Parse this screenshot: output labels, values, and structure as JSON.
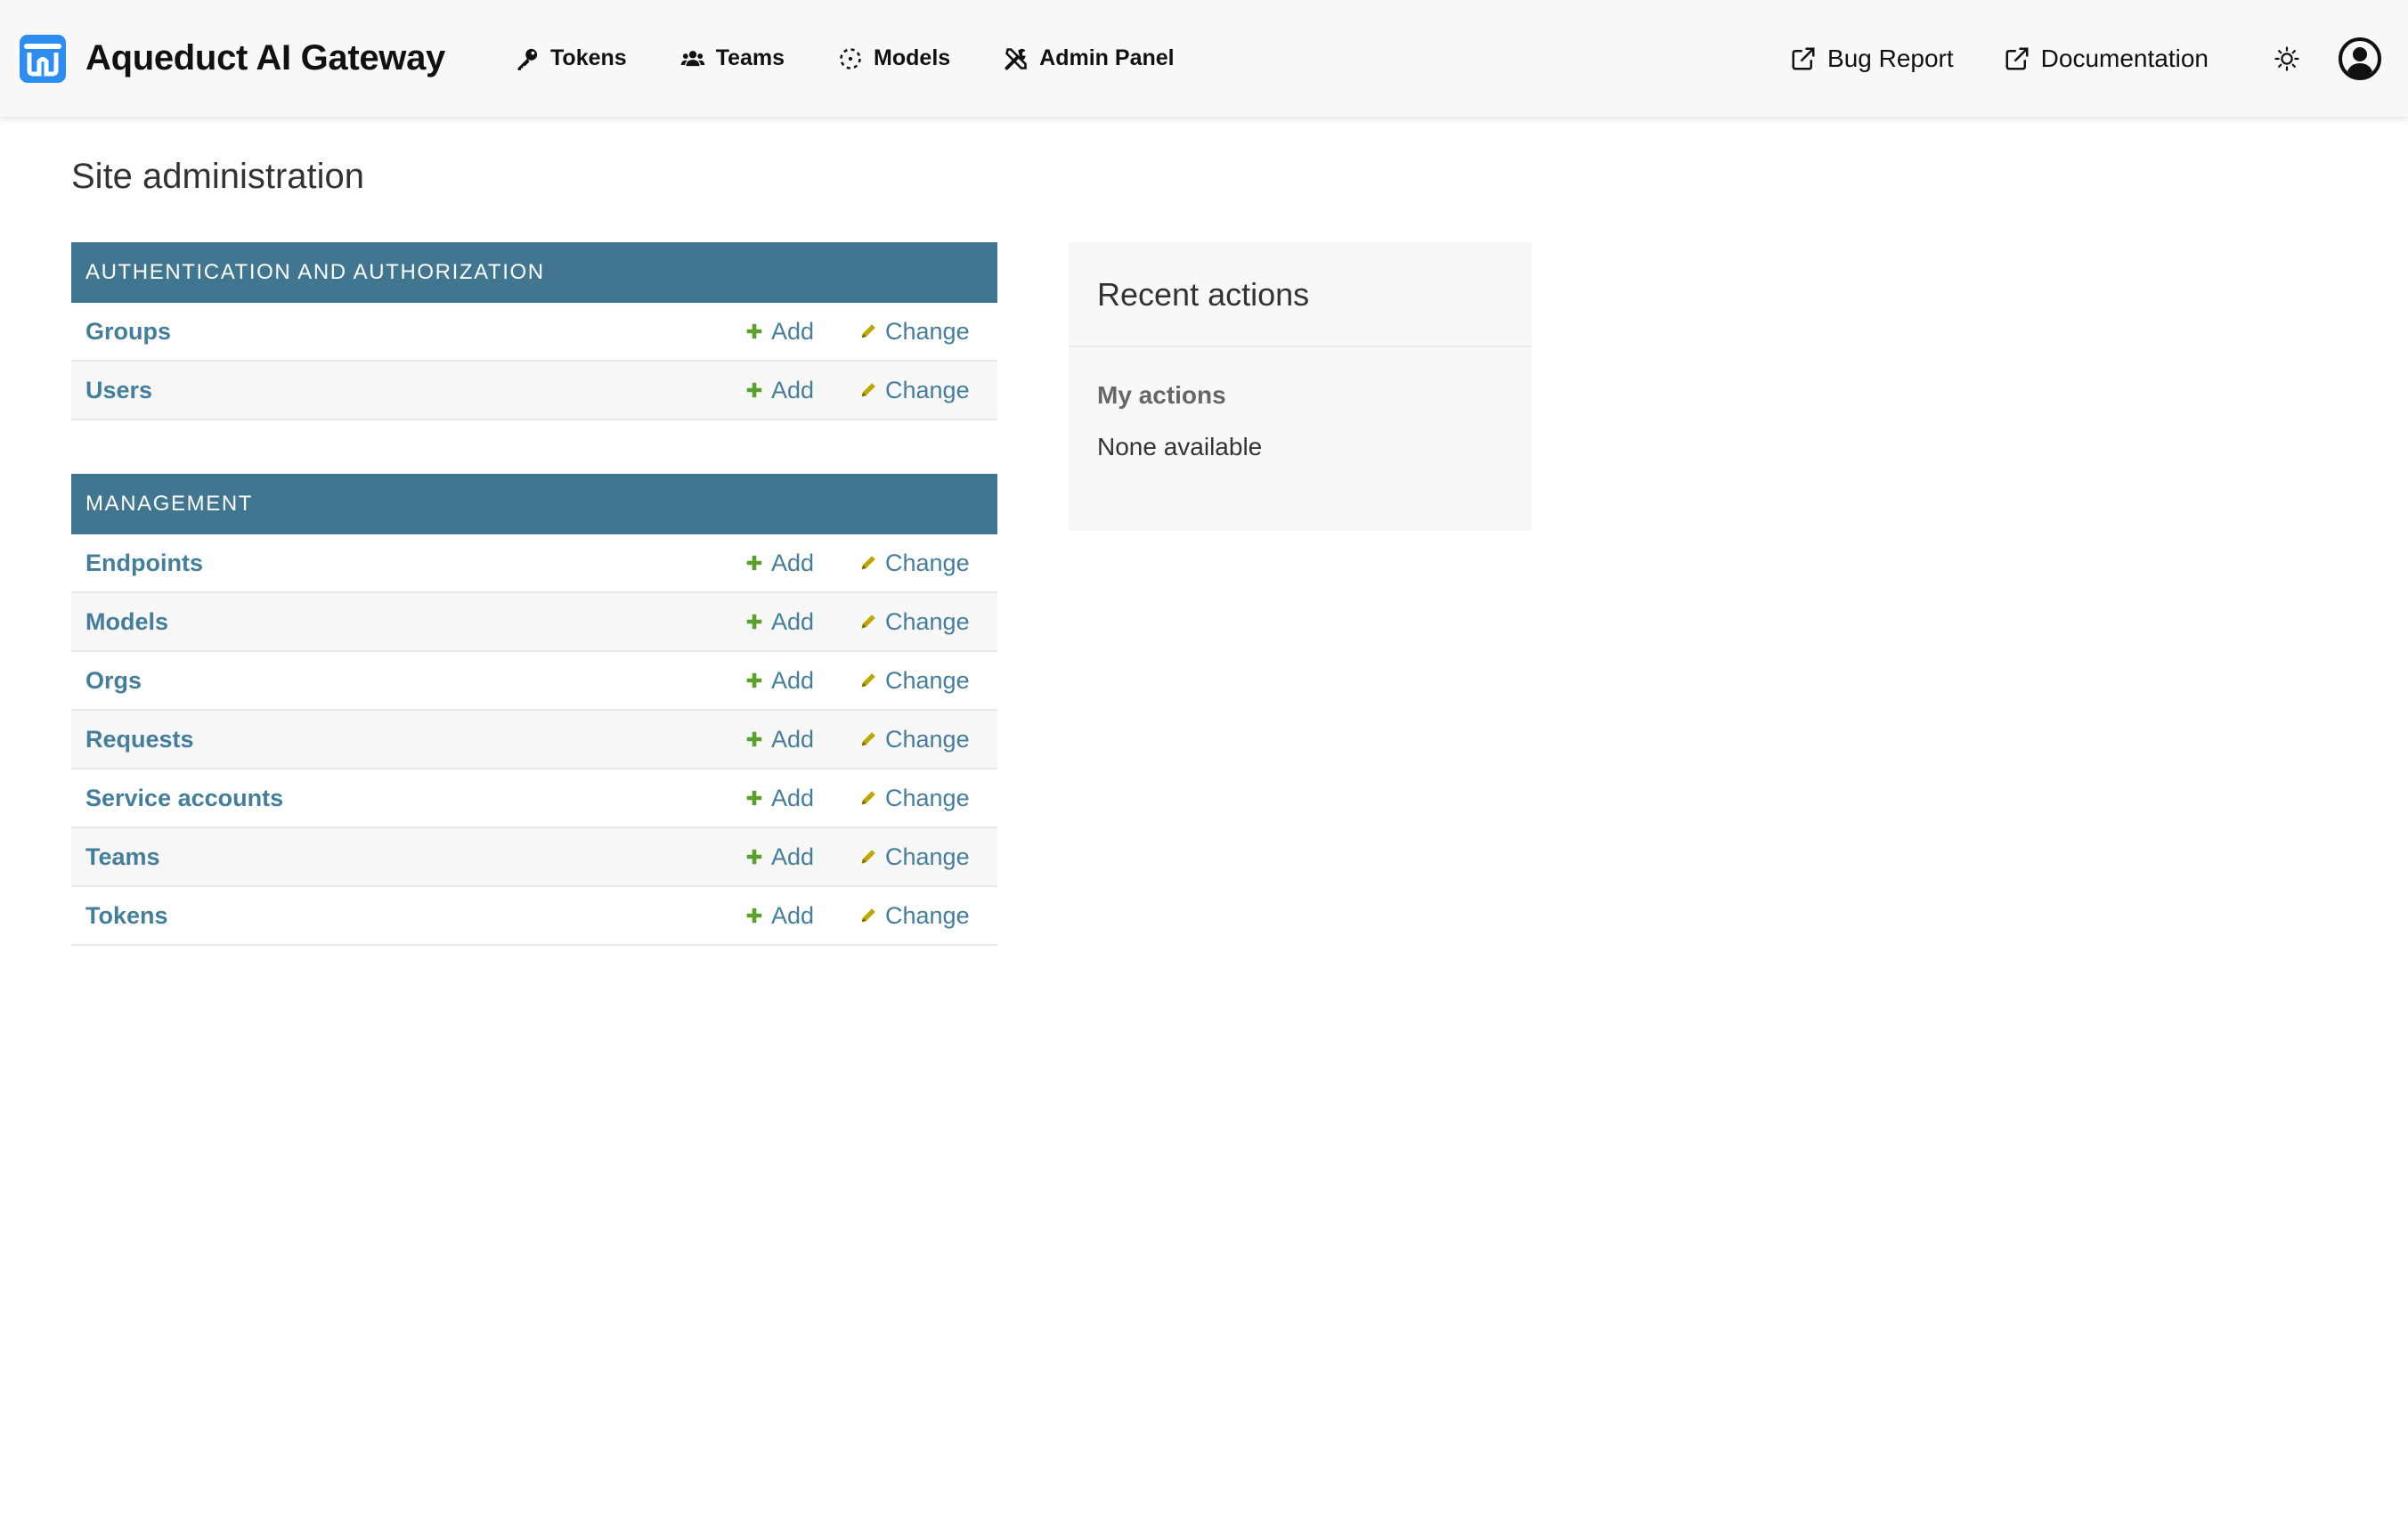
{
  "brand": {
    "name": "Aqueduct AI Gateway",
    "logo_color": "#2d8cf0"
  },
  "nav": {
    "items": [
      {
        "label": "Tokens",
        "icon": "key-icon"
      },
      {
        "label": "Teams",
        "icon": "users-icon"
      },
      {
        "label": "Models",
        "icon": "dashed-circle-icon"
      },
      {
        "label": "Admin Panel",
        "icon": "tools-icon"
      }
    ],
    "links": [
      {
        "label": "Bug Report",
        "icon": "external-link-icon"
      },
      {
        "label": "Documentation",
        "icon": "external-link-icon"
      }
    ]
  },
  "page": {
    "title": "Site administration"
  },
  "modules": [
    {
      "caption": "AUTHENTICATION AND AUTHORIZATION",
      "models": [
        "Groups",
        "Users"
      ]
    },
    {
      "caption": "MANAGEMENT",
      "models": [
        "Endpoints",
        "Models",
        "Orgs",
        "Requests",
        "Service accounts",
        "Teams",
        "Tokens"
      ]
    }
  ],
  "actions": {
    "add": "Add",
    "change": "Change"
  },
  "recent": {
    "title": "Recent actions",
    "subtitle": "My actions",
    "empty": "None available"
  },
  "colors": {
    "module_header": "#417690",
    "link": "#447e9b",
    "add_icon": "#5aa02c",
    "change_icon": "#c1a500"
  }
}
